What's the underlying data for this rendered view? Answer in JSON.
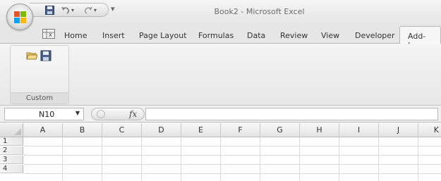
{
  "window": {
    "title": "Book2 - Microsoft Excel"
  },
  "quick_access": {
    "items": [
      "save-icon",
      "undo-icon",
      "redo-icon",
      "customize-dropdown-icon"
    ]
  },
  "tabs": [
    {
      "label": "Home",
      "active": false
    },
    {
      "label": "Insert",
      "active": false
    },
    {
      "label": "Page Layout",
      "active": false
    },
    {
      "label": "Formulas",
      "active": false
    },
    {
      "label": "Data",
      "active": false
    },
    {
      "label": "Review",
      "active": false
    },
    {
      "label": "View",
      "active": false
    },
    {
      "label": "Developer",
      "active": false
    },
    {
      "label": "Add-Ins",
      "active": true
    }
  ],
  "ribbon": {
    "group_label": "Custom Toolbars",
    "tools": [
      "open-folder-icon",
      "save-icon"
    ]
  },
  "formula_bar": {
    "name_box_value": "N10",
    "fx_label": "fx",
    "formula_value": ""
  },
  "sheet": {
    "columns": [
      "A",
      "B",
      "C",
      "D",
      "E",
      "F",
      "G",
      "H",
      "I",
      "J",
      "K"
    ],
    "rows": [
      "1",
      "2",
      "3",
      "4"
    ]
  },
  "colors": {
    "ribbon_bg": "#ececec",
    "title_text": "#6b6b6b",
    "active_tab_bg": "#f7f7f7"
  }
}
